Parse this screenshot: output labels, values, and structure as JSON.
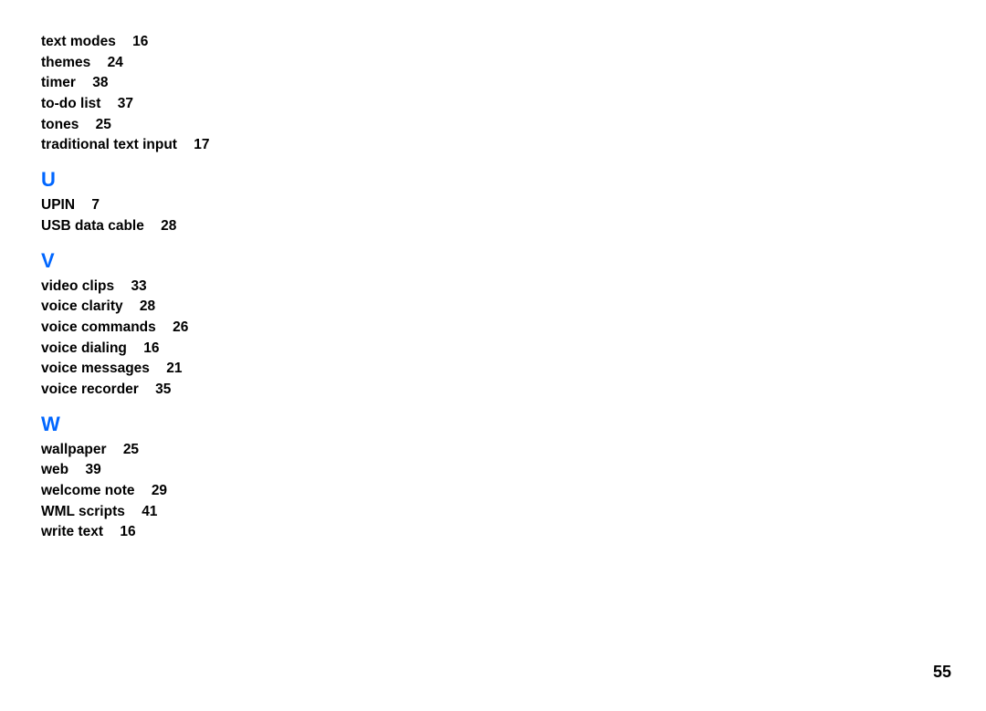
{
  "sections": {
    "t_entries": [
      {
        "term": "text modes",
        "page": "16"
      },
      {
        "term": "themes",
        "page": "24"
      },
      {
        "term": "timer",
        "page": "38"
      },
      {
        "term": "to-do list",
        "page": "37"
      },
      {
        "term": "tones",
        "page": "25"
      },
      {
        "term": "traditional text input",
        "page": "17"
      }
    ],
    "u_letter": "U",
    "u_entries": [
      {
        "term": "UPIN",
        "page": "7"
      },
      {
        "term": "USB data cable",
        "page": "28"
      }
    ],
    "v_letter": "V",
    "v_entries": [
      {
        "term": "video clips",
        "page": "33"
      },
      {
        "term": "voice clarity",
        "page": "28"
      },
      {
        "term": "voice commands",
        "page": "26"
      },
      {
        "term": "voice dialing",
        "page": "16"
      },
      {
        "term": "voice messages",
        "page": "21"
      },
      {
        "term": "voice recorder",
        "page": "35"
      }
    ],
    "w_letter": "W",
    "w_entries": [
      {
        "term": "wallpaper",
        "page": "25"
      },
      {
        "term": "web",
        "page": "39"
      },
      {
        "term": "welcome note",
        "page": "29"
      },
      {
        "term": "WML scripts",
        "page": "41"
      },
      {
        "term": "write text",
        "page": "16"
      }
    ]
  },
  "page_number": "55"
}
